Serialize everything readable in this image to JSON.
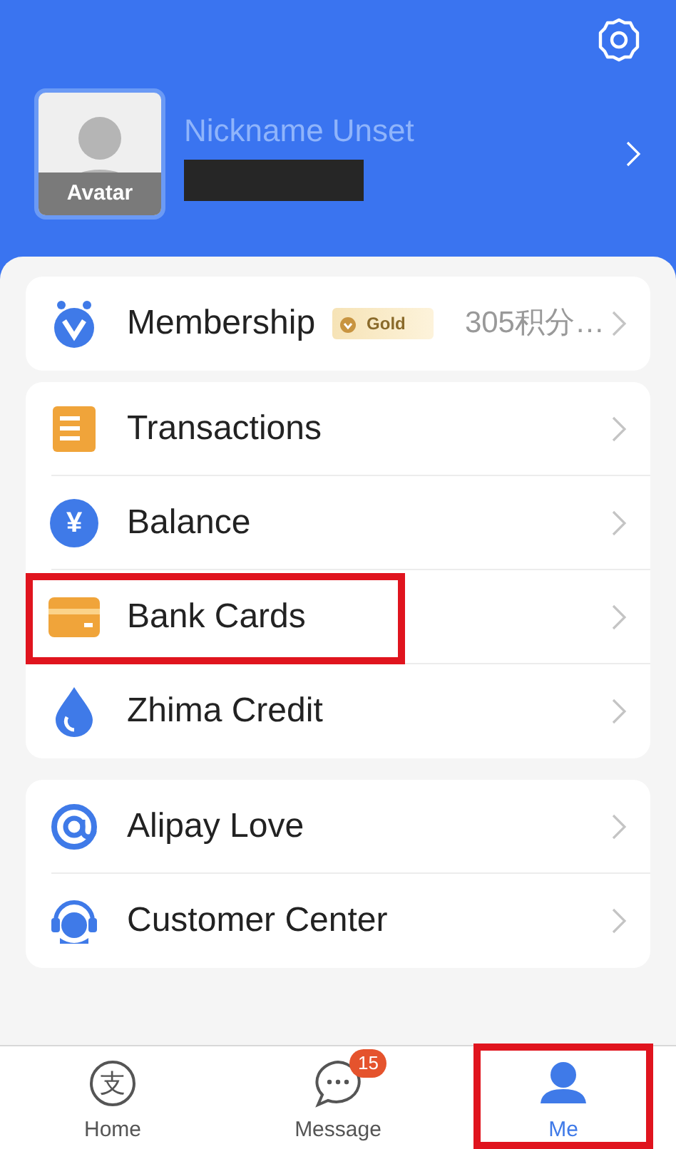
{
  "profile": {
    "avatar_label": "Avatar",
    "nickname": "Nickname Unset"
  },
  "groups": [
    [
      {
        "kind": "membership",
        "label": "Membership",
        "badge": "Gold",
        "value": "305积分…",
        "highlighted": false
      }
    ],
    [
      {
        "kind": "transactions",
        "label": "Transactions",
        "highlighted": false
      },
      {
        "kind": "balance",
        "label": "Balance",
        "glyph": "¥",
        "highlighted": false
      },
      {
        "kind": "card",
        "label": "Bank Cards",
        "highlighted": true
      },
      {
        "kind": "drop",
        "label": "Zhima Credit",
        "highlighted": false
      }
    ],
    [
      {
        "kind": "love",
        "label": "Alipay Love",
        "highlighted": false
      },
      {
        "kind": "service",
        "label": "Customer Center",
        "highlighted": false
      }
    ]
  ],
  "tabs": [
    {
      "kind": "home",
      "glyph": "支",
      "label": "Home",
      "selected": false,
      "highlighted": false
    },
    {
      "kind": "message",
      "label": "Message",
      "badge": "15",
      "selected": false,
      "highlighted": false
    },
    {
      "kind": "me",
      "label": "Me",
      "selected": true,
      "highlighted": true
    }
  ]
}
